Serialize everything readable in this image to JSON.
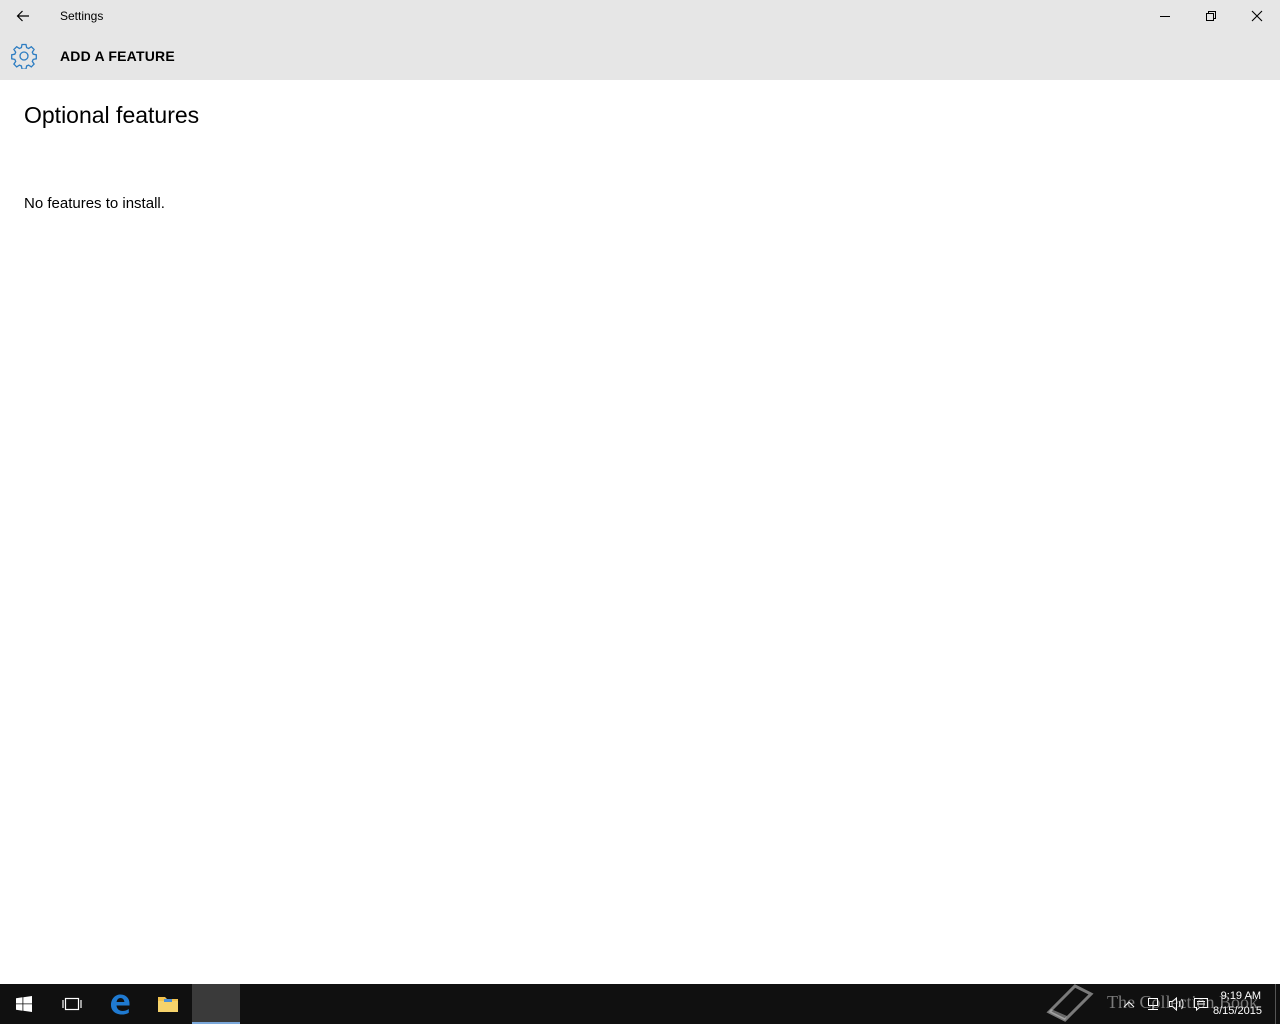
{
  "window": {
    "title": "Settings",
    "header_title": "ADD A FEATURE"
  },
  "content": {
    "page_title": "Optional features",
    "empty_message": "No features to install."
  },
  "taskbar": {
    "time": "9:19 AM",
    "date": "8/15/2015",
    "apps": [
      "start",
      "task-view",
      "edge",
      "file-explorer",
      "settings"
    ]
  },
  "watermark": {
    "text": "The Collection Book"
  },
  "colors": {
    "accent": "#2d7dc2",
    "titlebar": "#e6e6e6",
    "taskbar": "#101010"
  }
}
